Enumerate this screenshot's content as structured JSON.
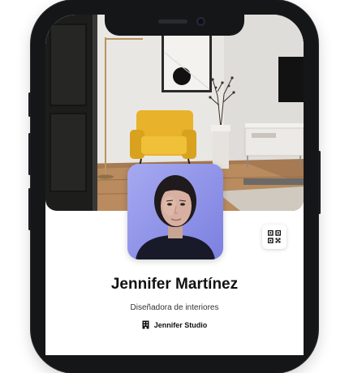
{
  "profile": {
    "name": "Jennifer Martínez",
    "title": "Diseñadora de interiores",
    "company": "Jennifer Studio"
  },
  "icons": {
    "qr": "qr-code-icon",
    "company": "building-icon"
  },
  "colors": {
    "text_primary": "#111111",
    "text_secondary": "#333333",
    "chair_accent": "#e8b22a",
    "avatar_bg": "#8f92e6"
  }
}
